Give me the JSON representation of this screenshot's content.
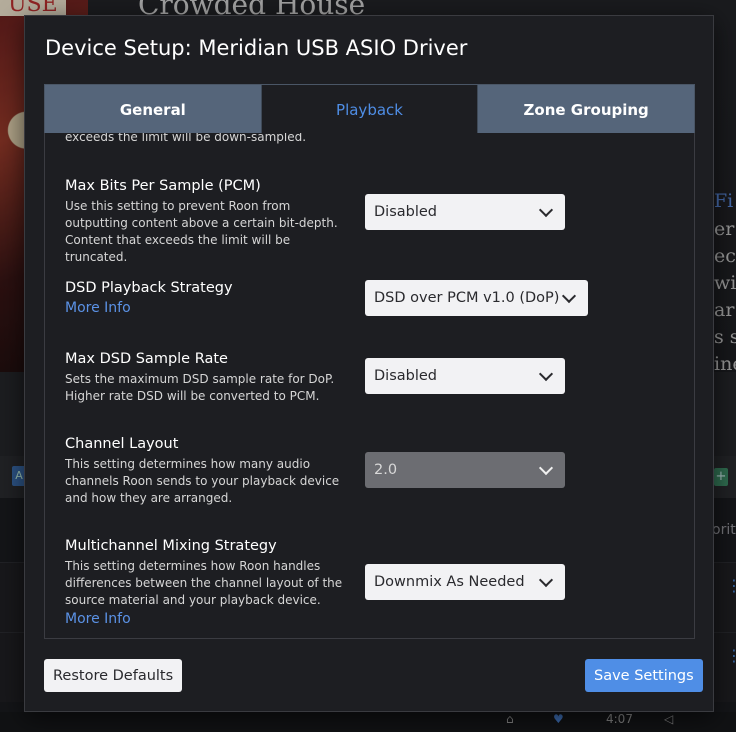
{
  "background": {
    "album_label": "USE",
    "album_title": "Crowded House",
    "right_text_link": "Fi",
    "right_text_lines": [
      "er",
      "ecc",
      "wi",
      "ar w",
      "s se",
      "ine"
    ],
    "tag_a": "A",
    "tag_plus": "+",
    "favorites_partial": "orit",
    "player_time": "4:07"
  },
  "modal": {
    "title": "Device Setup: Meridian USB ASIO Driver",
    "tabs": [
      {
        "label": "General",
        "active": false
      },
      {
        "label": "Playback",
        "active": true
      },
      {
        "label": "Zone Grouping",
        "active": false
      }
    ],
    "cut_text": "exceeds the limit will be down-sampled.",
    "settings": {
      "max_bits": {
        "title": "Max Bits Per Sample (PCM)",
        "desc": "Use this setting to prevent Roon from outputting content above a certain bit-depth. Content that exceeds the limit will be truncated.",
        "value": "Disabled"
      },
      "dsd_strategy": {
        "title": "DSD Playback Strategy",
        "more_info": "More Info",
        "value": "DSD over PCM v1.0 (DoP)"
      },
      "max_dsd_rate": {
        "title": "Max DSD Sample Rate",
        "desc": "Sets the maximum DSD sample rate for DoP. Higher rate DSD will be converted to PCM.",
        "value": "Disabled"
      },
      "channel_layout": {
        "title": "Channel Layout",
        "desc": "This setting determines how many audio channels Roon sends to your playback device and how they are arranged.",
        "value": "2.0",
        "disabled": true
      },
      "multichannel_mixing": {
        "title": "Multichannel Mixing Strategy",
        "desc": "This setting determines how Roon handles differences between the channel layout of the source material and your playback device.",
        "more_info": "More Info",
        "value": "Downmix As Needed"
      }
    },
    "buttons": {
      "restore": "Restore Defaults",
      "save": "Save Settings"
    }
  },
  "colors": {
    "accent": "#4f8ee6",
    "tab_inactive": "#55657a",
    "modal_bg": "#1d1e22"
  }
}
